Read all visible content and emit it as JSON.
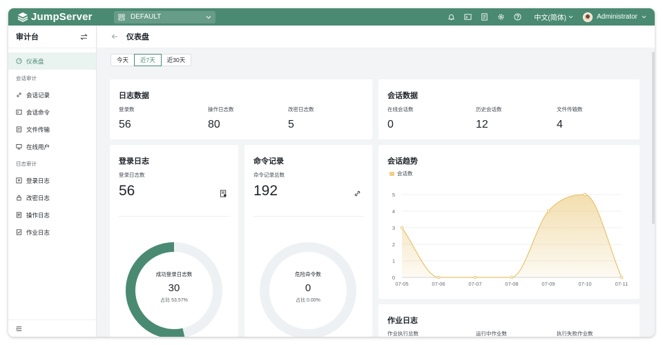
{
  "app": {
    "name": "JumpServer"
  },
  "topbar": {
    "org": "DEFAULT",
    "language": "中文(简体)",
    "user": "Administrator"
  },
  "sidebar": {
    "title": "审计台",
    "dashboard": "仪表盘",
    "group_session": "会话审计",
    "session_items": [
      "会话记录",
      "会话命令",
      "文件传输",
      "在线用户"
    ],
    "group_log": "日志审计",
    "log_items": [
      "登录日志",
      "改密日志",
      "操作日志",
      "作业日志"
    ]
  },
  "page": {
    "title": "仪表盘"
  },
  "range_tabs": [
    "今天",
    "近7天",
    "近30天"
  ],
  "log_data": {
    "title": "日志数据",
    "stats": [
      {
        "label": "登录数",
        "value": "56"
      },
      {
        "label": "操作日志数",
        "value": "80"
      },
      {
        "label": "改密日志数",
        "value": "5"
      }
    ]
  },
  "session_data": {
    "title": "会话数据",
    "stats": [
      {
        "label": "在线会话数",
        "value": "0"
      },
      {
        "label": "历史会话数",
        "value": "12"
      },
      {
        "label": "文件传输数",
        "value": "4"
      }
    ]
  },
  "login_log": {
    "title": "登录日志",
    "label": "登录日志数",
    "value": "56",
    "gauge_label": "成功登录日志数",
    "gauge_value": "30",
    "gauge_pct": "占比 53.57%",
    "ratio": 0.5357
  },
  "command_log": {
    "title": "命令记录",
    "label": "命令记录总数",
    "value": "192",
    "gauge_label": "危险命令数",
    "gauge_value": "0",
    "gauge_pct": "占比 0.00%",
    "ratio": 0
  },
  "session_trend": {
    "title": "会话趋势",
    "chart_data": {
      "type": "area",
      "title": "会话趋势",
      "categories": [
        "07-05",
        "07-06",
        "07-07",
        "07-08",
        "07-09",
        "07-10",
        "07-11"
      ],
      "series": [
        {
          "name": "会话数",
          "values": [
            3,
            0,
            0,
            0,
            4,
            5,
            0
          ]
        }
      ],
      "yticks": [
        "0",
        "1",
        "2",
        "3",
        "4",
        "5"
      ],
      "ylim": [
        0,
        5
      ],
      "legend": "top-left",
      "color": "#e8c36d"
    }
  },
  "job_log": {
    "title": "作业日志",
    "stats": [
      {
        "label": "作业执行总数"
      },
      {
        "label": "运行中作业数"
      },
      {
        "label": "执行失败作业数"
      }
    ]
  },
  "colors": {
    "brand": "#4a8a73",
    "gauge_track": "#eef1f4",
    "trend": "#e8c36d"
  }
}
